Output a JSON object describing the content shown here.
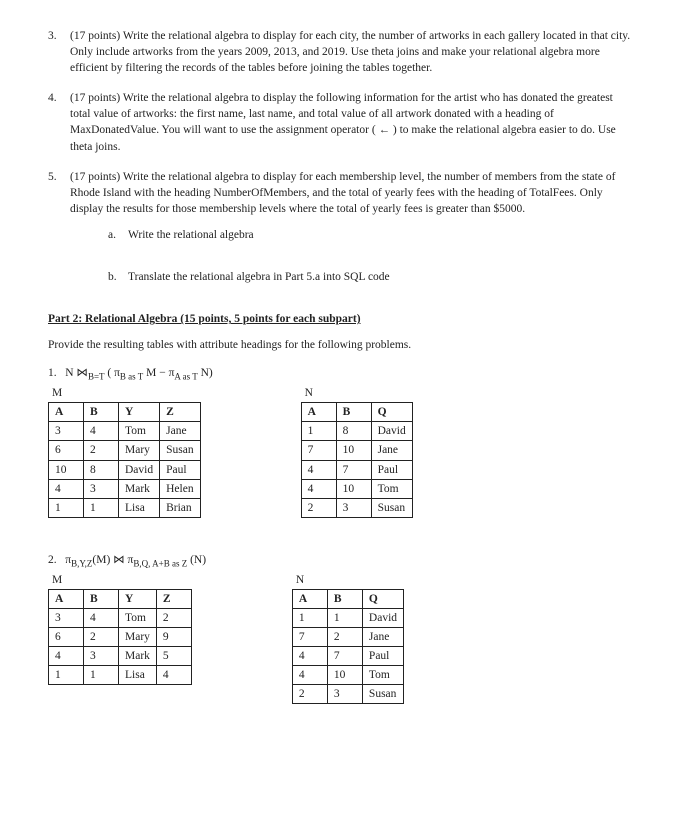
{
  "questions": [
    {
      "num": "3.",
      "text": "(17 points) Write the relational algebra to display for each city, the number of artworks in each gallery located in that city. Only include artworks from the years 2009, 2013, and 2019. Use theta joins and make your relational algebra more efficient by filtering the records of the tables before joining the tables together."
    },
    {
      "num": "4.",
      "text": "(17 points) Write the relational algebra to display the following information for the artist who has donated the greatest total value of artworks: the first name, last name, and total value of all artwork donated with a heading of MaxDonatedValue. You will want to use the assignment operator ( ← ) to make the relational algebra easier to do. Use theta joins."
    },
    {
      "num": "5.",
      "text": "(17 points) Write the relational algebra to display for each membership level, the number of members from the state of Rhode Island with the heading NumberOfMembers, and the total of yearly fees with the heading of TotalFees. Only display the results for those membership levels where the total of yearly fees is greater than $5000.",
      "subs": [
        {
          "num": "a.",
          "text": "Write the relational algebra"
        },
        {
          "num": "b.",
          "text": "Translate the relational algebra in Part 5.a into SQL code"
        }
      ]
    }
  ],
  "part2": {
    "heading": "Part 2: Relational Algebra (15 points, 5 points for each subpart)",
    "instruction": "Provide the resulting tables with attribute headings for the following problems."
  },
  "problems": [
    {
      "num": "1.",
      "expr_html": "N ⋈<sub>B=T</sub> ( π<sub>B as T</sub> M − π<sub>A as T</sub> N)",
      "M": {
        "label": "M",
        "headers": [
          "A",
          "B",
          "Y",
          "Z"
        ],
        "rows": [
          [
            "3",
            "4",
            "Tom",
            "Jane"
          ],
          [
            "6",
            "2",
            "Mary",
            "Susan"
          ],
          [
            "10",
            "8",
            "David",
            "Paul"
          ],
          [
            "4",
            "3",
            "Mark",
            "Helen"
          ],
          [
            "1",
            "1",
            "Lisa",
            "Brian"
          ]
        ]
      },
      "N": {
        "label": "N",
        "headers": [
          "A",
          "B",
          "Q"
        ],
        "rows": [
          [
            "1",
            "8",
            "David"
          ],
          [
            "7",
            "10",
            "Jane"
          ],
          [
            "4",
            "7",
            "Paul"
          ],
          [
            "4",
            "10",
            "Tom"
          ],
          [
            "2",
            "3",
            "Susan"
          ]
        ]
      }
    },
    {
      "num": "2.",
      "expr_html": "π<sub>B,Y,Z</sub>(M) ⋈ π<sub>B,Q, A+B as Z</sub> (N)",
      "M": {
        "label": "M",
        "headers": [
          "A",
          "B",
          "Y",
          "Z"
        ],
        "rows": [
          [
            "3",
            "4",
            "Tom",
            "2"
          ],
          [
            "6",
            "2",
            "Mary",
            "9"
          ],
          [
            "4",
            "3",
            "Mark",
            "5"
          ],
          [
            "1",
            "1",
            "Lisa",
            "4"
          ]
        ]
      },
      "N": {
        "label": "N",
        "headers": [
          "A",
          "B",
          "Q"
        ],
        "rows": [
          [
            "1",
            "1",
            "David"
          ],
          [
            "7",
            "2",
            "Jane"
          ],
          [
            "4",
            "7",
            "Paul"
          ],
          [
            "4",
            "10",
            "Tom"
          ],
          [
            "2",
            "3",
            "Susan"
          ]
        ]
      }
    }
  ]
}
